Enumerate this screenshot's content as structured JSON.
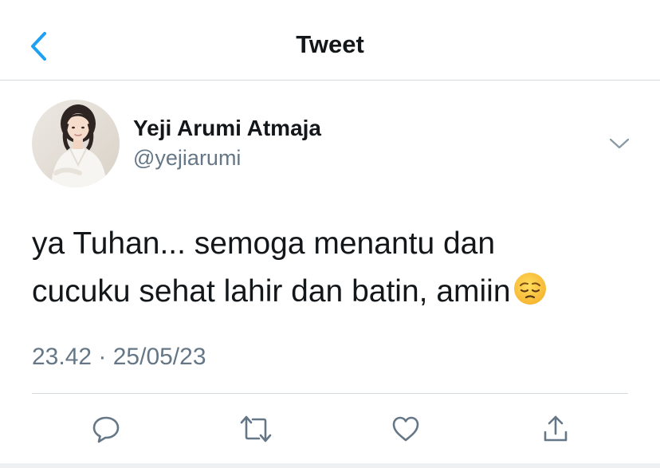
{
  "header": {
    "title": "Tweet",
    "back_icon": "chevron-left-icon"
  },
  "tweet": {
    "author": {
      "display_name": "Yeji Arumi Atmaja",
      "handle": "@yejiarumi"
    },
    "text_lines": [
      "ya Tuhan... semoga menantu dan",
      "cucuku sehat lahir dan batin, amiin"
    ],
    "emoji": "pensive-face-emoji",
    "timestamp": "23.42 · 25/05/23",
    "more_icon": "chevron-down-icon",
    "actions": [
      "reply-icon",
      "retweet-icon",
      "like-icon",
      "share-icon"
    ]
  },
  "colors": {
    "accent": "#1da1f2",
    "text": "#14171a",
    "secondary": "#657786",
    "divider": "#d6dbe0"
  }
}
